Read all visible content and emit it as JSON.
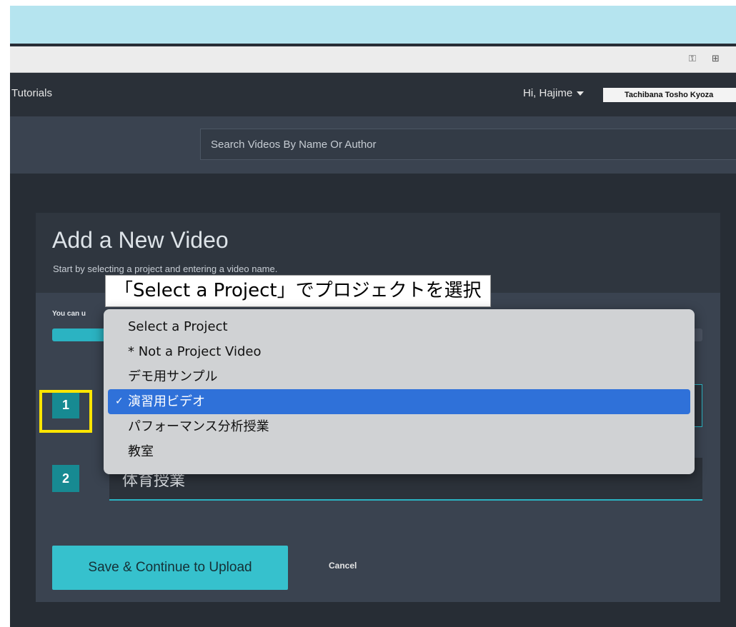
{
  "nav": {
    "tutorials": "Tutorials",
    "greeting": "Hi, Hajime",
    "org": "Tachibana Tosho Kyoza"
  },
  "browser": {
    "key_icon": "key-icon",
    "translate_icon": "translate-icon"
  },
  "search": {
    "placeholder": "Search Videos By Name Or Author"
  },
  "panel": {
    "title": "Add a New Video",
    "subtitle": "Start by selecting a project and entering a video name.",
    "upload_note": "You can u"
  },
  "steps": [
    {
      "number": "1"
    },
    {
      "number": "2",
      "value": "体育授業"
    }
  ],
  "progress": {
    "fraction": 0.09
  },
  "buttons": {
    "save": "Save & Continue to Upload",
    "cancel": "Cancel"
  },
  "callout": "「Select a Project」でプロジェクトを選択",
  "dropdown": {
    "options": [
      {
        "label": "Select a Project",
        "selected": false
      },
      {
        "label": "* Not a Project Video",
        "selected": false
      },
      {
        "label": "デモ用サンプル",
        "selected": false
      },
      {
        "label": "演習用ビデオ",
        "selected": true
      },
      {
        "label": "パフォーマンス分析授業",
        "selected": false
      },
      {
        "label": "教室",
        "selected": false
      }
    ],
    "check_glyph": "✓"
  },
  "colors": {
    "accent": "#2bb3c2",
    "highlight": "#ffe600",
    "selection": "#2f71d9"
  }
}
